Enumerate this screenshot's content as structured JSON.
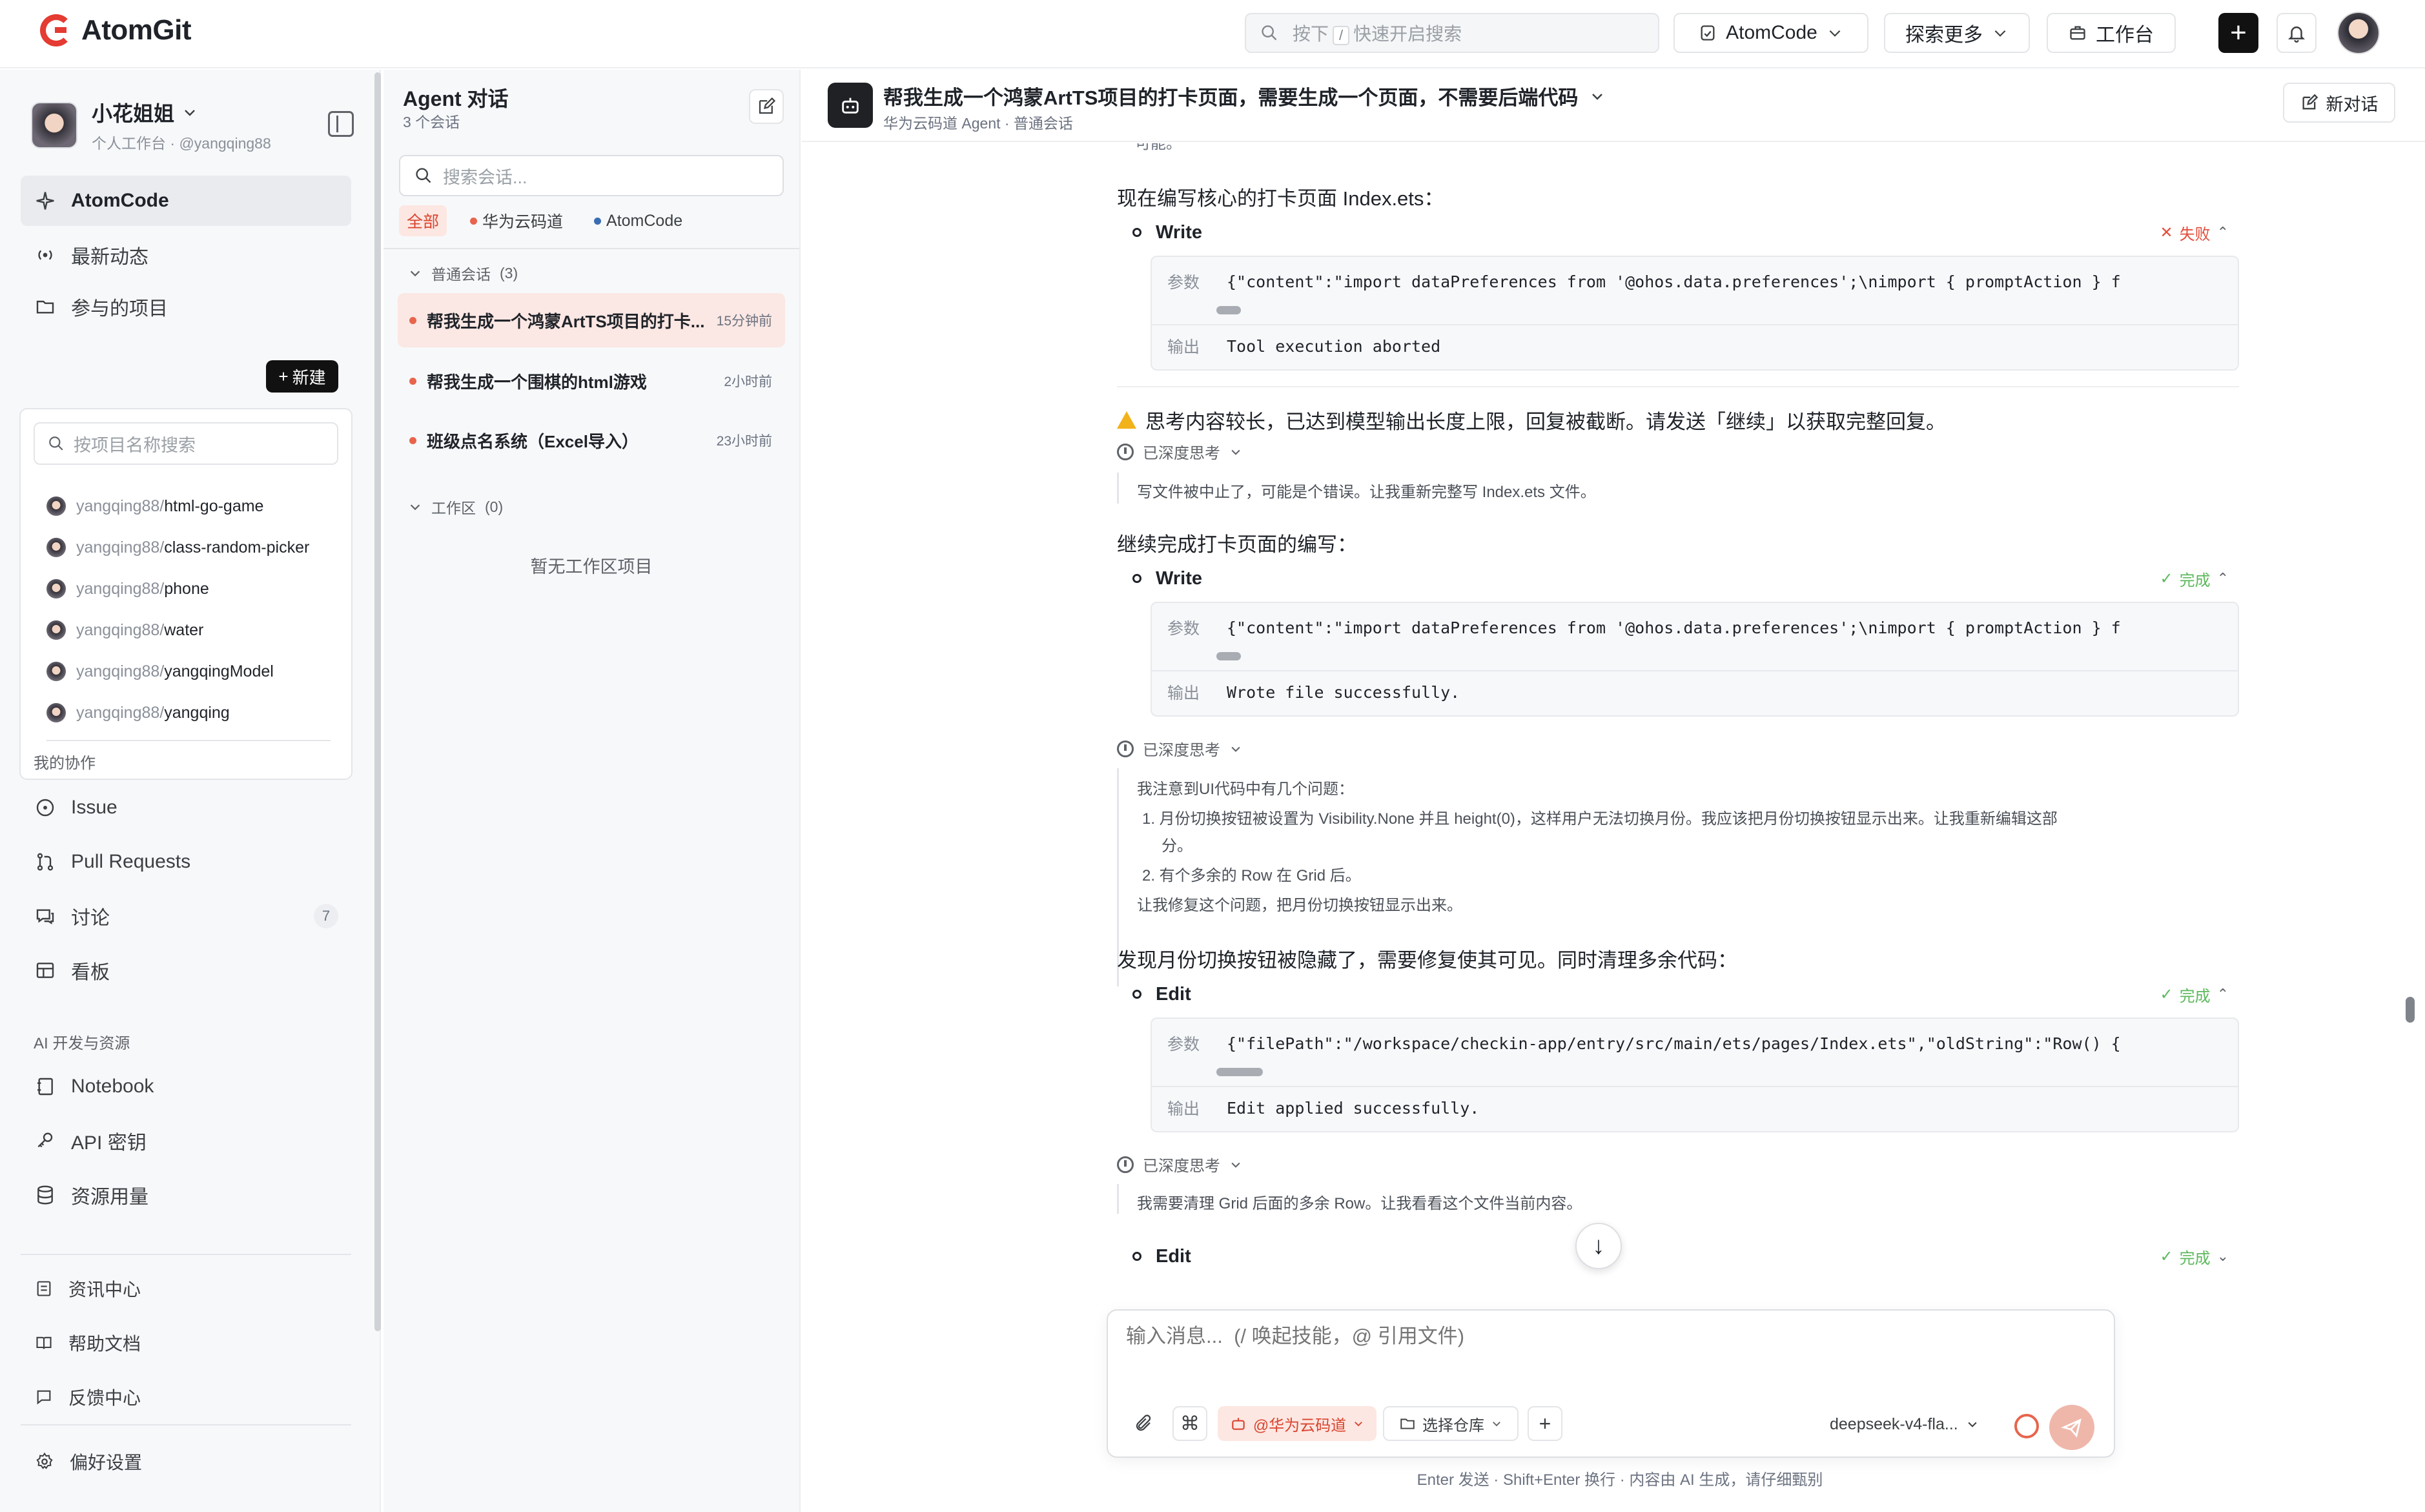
{
  "topbar": {
    "brand": "AtomGit",
    "search_hint_prefix": "按下",
    "search_key": "/",
    "search_hint_suffix": "快速开启搜索",
    "atomcode_label": "AtomCode",
    "explore_label": "探索更多",
    "workbench_label": "工作台"
  },
  "user": {
    "name": "小花姐姐",
    "subtitle": "个人工作台 · @yangqing88"
  },
  "nav": {
    "atomcode": "AtomCode",
    "news": "最新动态",
    "projects": "参与的项目",
    "new_label": "新建",
    "project_search_placeholder": "按项目名称搜索",
    "projects_list": [
      {
        "owner": "yangqing88/",
        "repo": "html-go-game"
      },
      {
        "owner": "yangqing88/",
        "repo": "class-random-picker"
      },
      {
        "owner": "yangqing88/",
        "repo": "phone"
      },
      {
        "owner": "yangqing88/",
        "repo": "water"
      },
      {
        "owner": "yangqing88/",
        "repo": "yangqingModel"
      },
      {
        "owner": "yangqing88/",
        "repo": "yangqing"
      }
    ],
    "collab_title": "我的协作",
    "issue": "Issue",
    "pull_requests": "Pull Requests",
    "discussions": "讨论",
    "discussions_count": "7",
    "board": "看板",
    "ai_title": "AI 开发与资源",
    "notebook": "Notebook",
    "api_keys": "API 密钥",
    "usage": "资源用量",
    "info_center": "资讯中心",
    "help_docs": "帮助文档",
    "feedback": "反馈中心",
    "preferences": "偏好设置"
  },
  "conversations": {
    "title": "Agent 对话",
    "count": "3 个会话",
    "search_placeholder": "搜索会话...",
    "filters": [
      {
        "label": "全部",
        "color": ""
      },
      {
        "label": "华为云码道",
        "color": "#e8644c"
      },
      {
        "label": "AtomCode",
        "color": "#3b6db3"
      }
    ],
    "group_normal": "普通会话",
    "group_normal_count": "(3)",
    "items": [
      {
        "title": "帮我生成一个鸿蒙ArtTS项目的打卡...",
        "time": "15分钟前"
      },
      {
        "title": "帮我生成一个围棋的html游戏",
        "time": "2小时前"
      },
      {
        "title": "班级点名系统（Excel导入）",
        "time": "23小时前"
      }
    ],
    "group_workspace": "工作区",
    "group_workspace_count": "(0)",
    "workspace_empty": "暂无工作区项目"
  },
  "chat": {
    "title": "帮我生成一个鸿蒙ArtTS项目的打卡页面，需要生成一个页面，不需要后端代码",
    "subtitle": "华为云码道 Agent · 普通会话",
    "new_chat": "新对话",
    "top_fragment": "可能。",
    "msg1": "现在编写核心的打卡页面 Index.ets：",
    "tool1": {
      "name": "Write",
      "status": "失败",
      "param_label": "参数",
      "param": "{\"content\":\"import dataPreferences from '@ohos.data.preferences';\\nimport { promptAction } f",
      "output_label": "输出",
      "output": "Tool execution aborted"
    },
    "warning": "思考内容较长，已达到模型输出长度上限，回复被截断。请发送「继续」以获取完整回复。",
    "think_label": "已深度思考",
    "think1": "写文件被中止了，可能是个错误。让我重新完整写 Index.ets 文件。",
    "msg2": "继续完成打卡页面的编写：",
    "tool2": {
      "name": "Write",
      "status": "完成",
      "param_label": "参数",
      "param": "{\"content\":\"import dataPreferences from '@ohos.data.preferences';\\nimport { promptAction } f",
      "output_label": "输出",
      "output": "Wrote file successfully."
    },
    "think2": {
      "intro": "我注意到UI代码中有几个问题：",
      "item1a": "1. 月份切换按钮被设置为 Visibility.None 并且 height(0)，这样用户无法切换月份。我应该把月份切换按钮显示出来。让我重新编辑这部",
      "item1b": "分。",
      "item2": "2. 有个多余的 Row 在 Grid 后。",
      "outro": "让我修复这个问题，把月份切换按钮显示出来。"
    },
    "msg3": "发现月份切换按钮被隐藏了，需要修复使其可见。同时清理多余代码：",
    "tool3": {
      "name": "Edit",
      "status": "完成",
      "param_label": "参数",
      "param": "{\"filePath\":\"/workspace/checkin-app/entry/src/main/ets/pages/Index.ets\",\"oldString\":\"Row() {",
      "output_label": "输出",
      "output": "Edit applied successfully."
    },
    "think3": "我需要清理 Grid 后面的多余 Row。让我看看这个文件当前内容。",
    "tool4": {
      "name": "Edit",
      "status": "完成"
    }
  },
  "composer": {
    "placeholder": "输入消息...  (/ 唤起技能，@ 引用文件)",
    "huawei_tag": "@华为云码道",
    "repo_select": "选择仓库",
    "model": "deepseek-v4-fla...",
    "hint": "Enter 发送 · Shift+Enter 换行 · 内容由 AI 生成，请仔细甄别"
  },
  "colors": {
    "accent": "#e8644c",
    "fail": "#e34d3b",
    "ok": "#5cb85c"
  }
}
